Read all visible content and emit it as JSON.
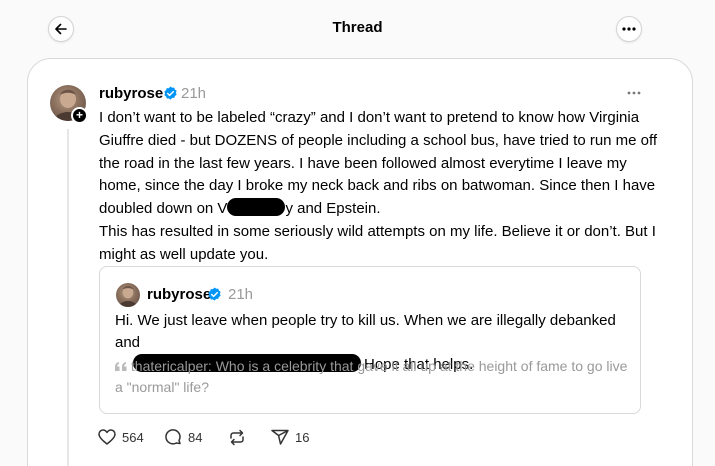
{
  "header": {
    "title": "Thread"
  },
  "post": {
    "username": "rubyrose",
    "timestamp": "21h",
    "paragraphs": {
      "p1_a": "I don’t want to be labeled “crazy” and I don’t want to pretend to know how Virginia Giuffre died - but DOZENS of people including a school bus, have tried to run me off the road in the last few years. I have been followed almost everytime I leave my home, since the day I broke my neck back and ribs on batwoman. Since then I have doubled down on V",
      "p1_b": "y and Epstein.",
      "p2": "This has resulted in some seriously wild attempts on my life. Believe it or don’t. But I might as well update you."
    },
    "actions": {
      "likes": "564",
      "comments": "84",
      "shares": "16"
    }
  },
  "quote": {
    "username": "rubyrose",
    "timestamp": "21h",
    "body_a": "Hi. We just leave when people try to kill us. When we are illegally debanked and",
    "body_b": "Hope that helps.",
    "reply_prefix": "thatericalper:",
    "reply_text": "Who is a celebrity that gave it all up at the height of fame to go live a \"normal\" life?"
  },
  "icons": {
    "back": "arrow-left-icon",
    "more": "ellipsis-icon",
    "verified": "verified-badge-icon",
    "like": "heart-icon",
    "comment": "speech-bubble-icon",
    "repost": "repost-icon",
    "share": "paper-plane-icon"
  },
  "colors": {
    "verified": "#0095f6",
    "muted": "#999999"
  }
}
